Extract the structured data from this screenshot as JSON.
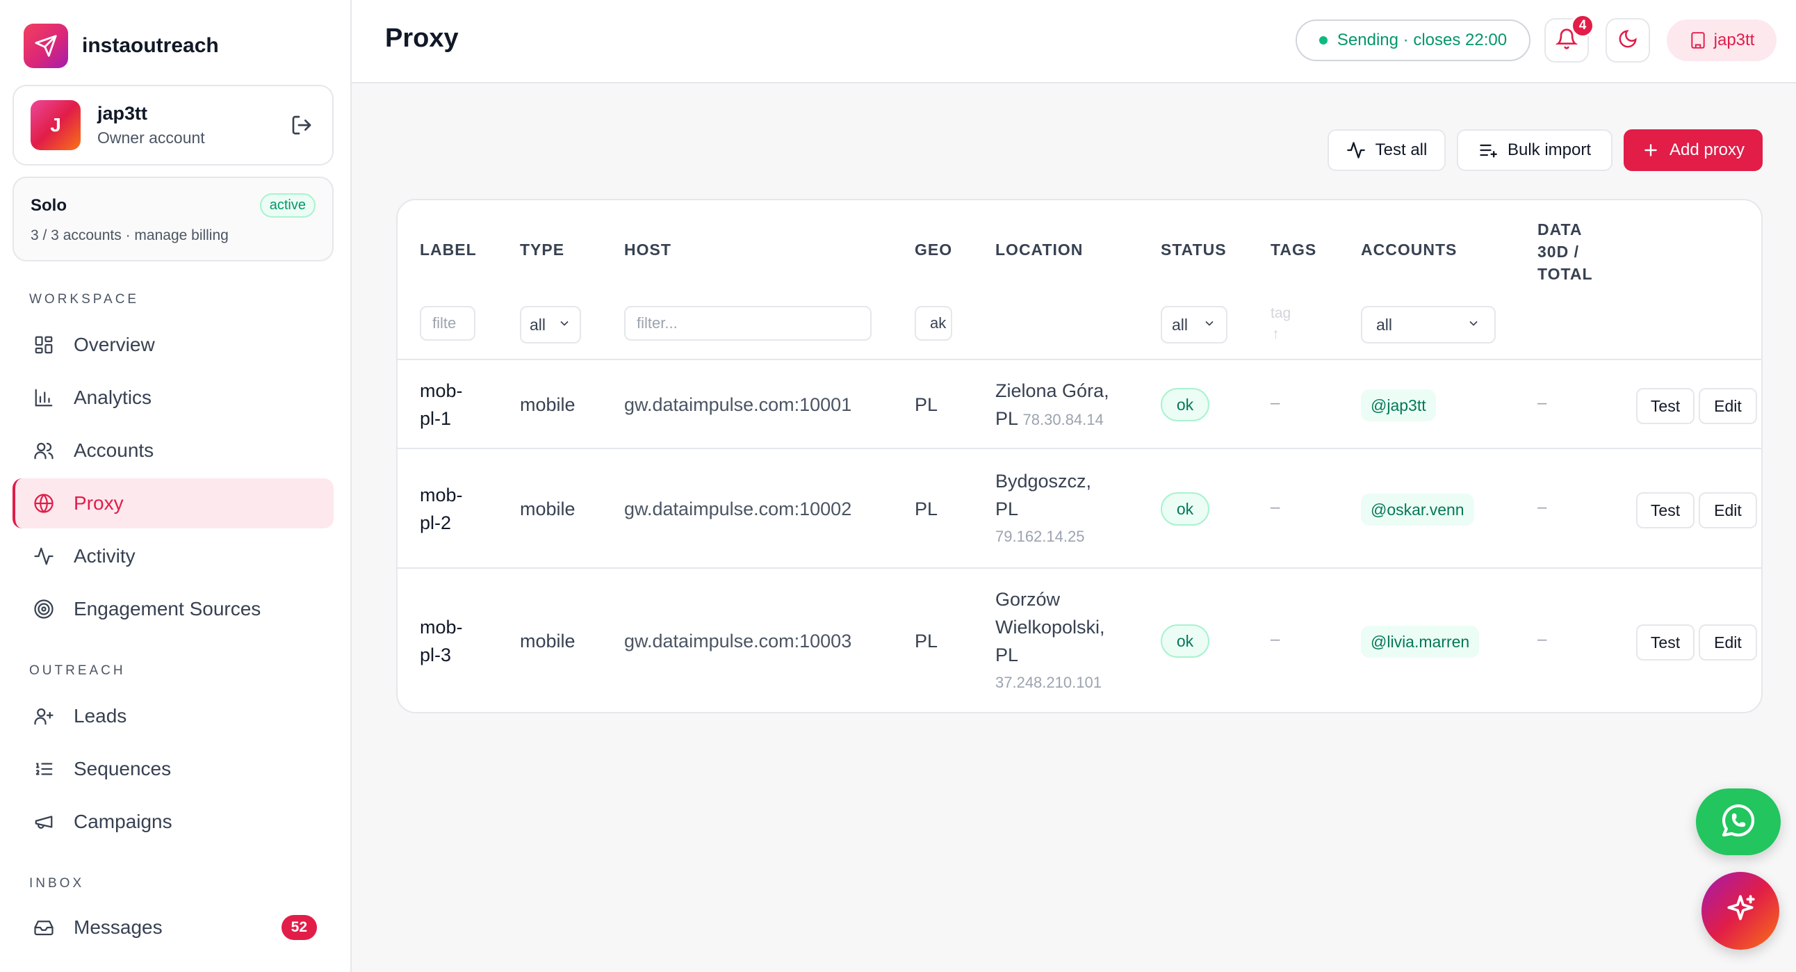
{
  "brand": {
    "name": "instaoutreach"
  },
  "user": {
    "initial": "J",
    "name": "jap3tt",
    "role": "Owner account"
  },
  "plan": {
    "name": "Solo",
    "status": "active",
    "usage": "3 / 3 accounts · manage billing"
  },
  "sidebar": {
    "sections": {
      "workspace": "WORKSPACE",
      "outreach": "OUTREACH",
      "inbox": "INBOX"
    },
    "items": [
      {
        "label": "Overview",
        "icon": "grid-icon"
      },
      {
        "label": "Analytics",
        "icon": "bar-chart-icon"
      },
      {
        "label": "Accounts",
        "icon": "users-icon"
      },
      {
        "label": "Proxy",
        "icon": "globe-icon",
        "active": true
      },
      {
        "label": "Activity",
        "icon": "activity-icon"
      },
      {
        "label": "Engagement Sources",
        "icon": "target-icon"
      },
      {
        "label": "Leads",
        "icon": "user-plus-icon"
      },
      {
        "label": "Sequences",
        "icon": "list-ordered-icon"
      },
      {
        "label": "Campaigns",
        "icon": "megaphone-icon"
      },
      {
        "label": "Messages",
        "icon": "inbox-icon",
        "count": "52"
      }
    ]
  },
  "header": {
    "title": "Proxy",
    "sending_status": "Sending · closes 22:00",
    "notification_count": "4",
    "user_chip": "jap3tt"
  },
  "toolbar": {
    "test_all": "Test all",
    "bulk_import": "Bulk import",
    "add_proxy": "Add proxy"
  },
  "table": {
    "columns": {
      "label": "LABEL",
      "type": "TYPE",
      "host": "HOST",
      "geo": "GEO",
      "location": "LOCATION",
      "status": "STATUS",
      "tags": "TAGS",
      "accounts": "ACCOUNTS",
      "data_line1": "DATA",
      "data_line2": "30D /",
      "data_line3": "TOTAL"
    },
    "filters": {
      "label_placeholder": "filte",
      "type_value": "all",
      "host_placeholder": "filter...",
      "geo_placeholder": "ak",
      "status_value": "all",
      "tags_placeholder": "tag",
      "tags_sort": "↑",
      "accounts_value": "all"
    },
    "rows": [
      {
        "label_1": "mob-",
        "label_2": "pl-1",
        "type": "mobile",
        "host": "gw.dataimpulse.com:10001",
        "geo": "PL",
        "loc_1": "Zielona Góra,",
        "loc_2": "PL",
        "ip": "78.30.84.14",
        "status": "ok",
        "tags": "–",
        "account": "@jap3tt",
        "data": "–",
        "test": "Test",
        "edit": "Edit"
      },
      {
        "label_1": "mob-",
        "label_2": "pl-2",
        "type": "mobile",
        "host": "gw.dataimpulse.com:10002",
        "geo": "PL",
        "loc_1": "Bydgoszcz,",
        "loc_2": "PL",
        "ip": "79.162.14.25",
        "status": "ok",
        "tags": "–",
        "account": "@oskar.venn",
        "data": "–",
        "test": "Test",
        "edit": "Edit"
      },
      {
        "label_1": "mob-",
        "label_2": "pl-3",
        "type": "mobile",
        "host": "gw.dataimpulse.com:10003",
        "geo": "PL",
        "loc_1": "Gorzów",
        "loc_2": "Wielkopolski,",
        "loc_3": "PL",
        "ip": "37.248.210.101",
        "status": "ok",
        "tags": "–",
        "account": "@livia.marren",
        "data": "–",
        "test": "Test",
        "edit": "Edit"
      }
    ]
  },
  "colors": {
    "accent": "#e11d48",
    "success": "#059669",
    "whatsapp": "#22c55e"
  }
}
